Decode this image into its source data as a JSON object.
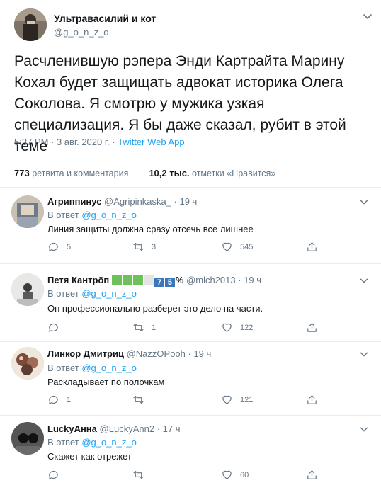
{
  "tweet": {
    "author_name": "Ультравасилий и кот",
    "author_handle": "@g_o_n_z_o",
    "text": "Расчленившую рэпера Энди Картрайта Марину Кохал будет защищать адвокат историка Олега Соколова. Я смотрю у мужика узкая специализация. Я бы даже сказал, рубит в этой теме",
    "time_date": "5:37 PM · 3 авг. 2020 г. · ",
    "source": "Twitter Web App",
    "retweets_count": "773",
    "retweets_label": "ретвита и комментария",
    "likes_count": "10,2 тыс.",
    "likes_label": "отметки «Нравится»"
  },
  "replies": [
    {
      "name": "Агриппинус",
      "handle": "@Agripinkaska_",
      "time": "· 19 ч",
      "in_reply_prefix": "В ответ ",
      "in_reply_handle": "@g_o_n_z_o",
      "text": "Линия защиты должна сразу отсечь все лишнее",
      "comments": "5",
      "retweets": "3",
      "likes": "545"
    },
    {
      "name": "Петя Кантрöп",
      "badge_digits": [
        "7",
        "5"
      ],
      "badge_percent": "%",
      "handle": "@mlch2013",
      "time": "· 19 ч",
      "in_reply_prefix": "В ответ ",
      "in_reply_handle": "@g_o_n_z_o",
      "text": "Он профессионально разберет это дело на части.",
      "comments": "",
      "retweets": "1",
      "likes": "122"
    },
    {
      "name": "Линкор Дмитриц",
      "handle": "@NazzOPooh",
      "time": "· 19 ч",
      "in_reply_prefix": "В ответ ",
      "in_reply_handle": "@g_o_n_z_o",
      "text": "Раскладывает по полочкам",
      "comments": "1",
      "retweets": "",
      "likes": "121"
    },
    {
      "name": "LuckyАнна",
      "handle": "@LuckyAnn2",
      "time": "· 17 ч",
      "in_reply_prefix": "В ответ ",
      "in_reply_handle": "@g_o_n_z_o",
      "text": "Скажет как отрежет",
      "comments": "",
      "retweets": "",
      "likes": "60"
    }
  ],
  "colors": {
    "accent": "#1da1f2",
    "secondary_text": "#657786",
    "primary_text": "#14171a",
    "divider": "#e6ecf0",
    "badge_green": "#6ec05a",
    "badge_blue": "#3b77b8"
  },
  "icons": [
    "chevron-down-icon",
    "comment-icon",
    "retweet-icon",
    "heart-icon",
    "share-icon"
  ]
}
